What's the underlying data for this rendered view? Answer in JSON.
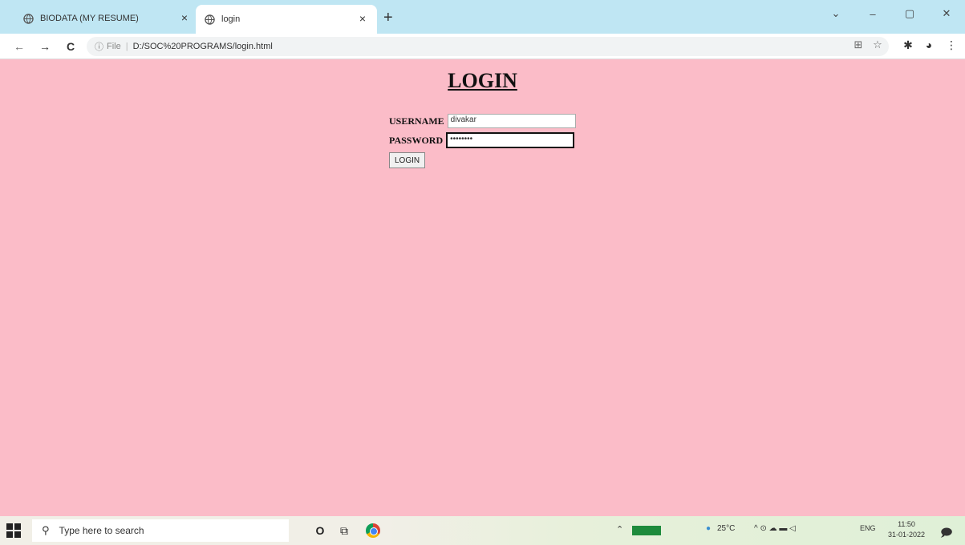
{
  "browser": {
    "tabs": [
      {
        "title": "BIODATA (MY RESUME)",
        "close": "×"
      },
      {
        "title": "login",
        "close": "×"
      }
    ],
    "new_tab": "+",
    "window_controls": {
      "minimize": "–",
      "maximize": "▢",
      "close": "✕",
      "collapse": "⌄"
    },
    "nav": {
      "back": "←",
      "forward": "→",
      "reload": "C"
    },
    "address": {
      "info_icon": "ⓘ",
      "scheme": "File",
      "separator": "|",
      "url": "D:/SOC%20PROGRAMS/login.html"
    },
    "toolbar_icons": {
      "reader": "⊞",
      "star": "☆",
      "extensions": "✱",
      "profile": "◕",
      "menu": "⋮"
    }
  },
  "page": {
    "background": "#fbbcc8",
    "heading": "LOGIN",
    "username_label": "USERNAME",
    "username_value": "divakar",
    "password_label": "PASSWORD",
    "password_value": "••••••••",
    "login_button": "LOGIN"
  },
  "taskbar": {
    "search_placeholder": "Type here to search",
    "search_icon": "⚲",
    "cortana": "O",
    "task_view": "⧉",
    "tray_chevron": "⌃",
    "battery_label": "",
    "temperature": "25°C",
    "tray_symbols": "^ ⊙ ☁ ▬ ◁",
    "language": "ENG",
    "time": "11:50",
    "date": "31-01-2022",
    "notification_icon": "🗩"
  }
}
